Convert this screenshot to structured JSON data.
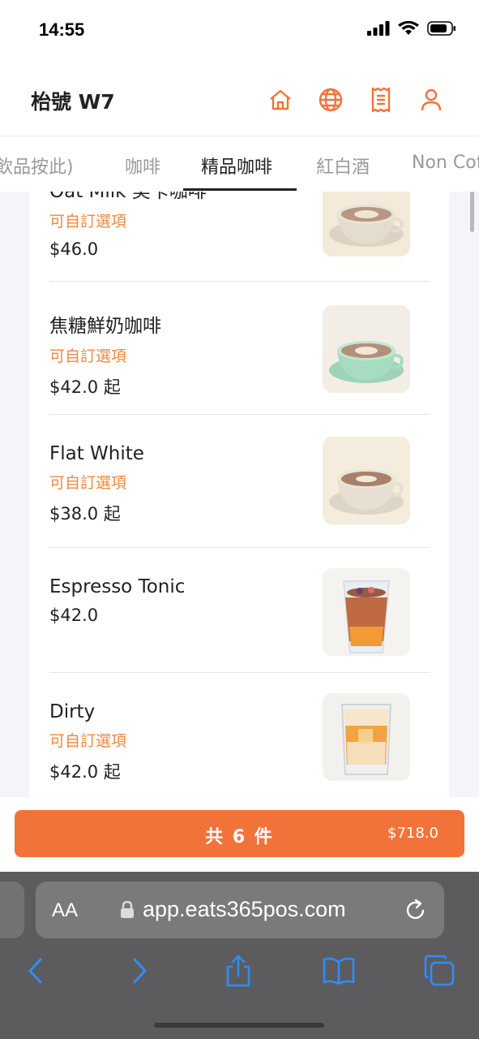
{
  "status": {
    "time": "14:55"
  },
  "header": {
    "store_name": "枱號 W7",
    "icons": [
      "home-icon",
      "globe-icon",
      "receipt-icon",
      "user-icon"
    ],
    "accent_color": "#f0733a"
  },
  "tabs": {
    "items": [
      "飲品按此)",
      "咖啡",
      "精品咖啡",
      "紅白酒",
      "Non Coffee"
    ],
    "active": "精品咖啡"
  },
  "menu": {
    "items": [
      {
        "name": "Oat Milk 美卡咖啡",
        "option": "可自訂選項",
        "price": "$46.0",
        "image": "latte-cup-beige"
      },
      {
        "name": "焦糖鮮奶咖啡",
        "option": "可自訂選項",
        "price": "$42.0 起",
        "image": "latte-cup-green"
      },
      {
        "name": "Flat White",
        "option": "可自訂選項",
        "price": "$38.0 起",
        "image": "latte-cup-beige"
      },
      {
        "name": "Espresso Tonic",
        "option": "",
        "price": "$42.0",
        "image": "iced-espresso-tonic"
      },
      {
        "name": "Dirty",
        "option": "可自訂選項",
        "price": "$42.0 起",
        "image": "dirty-coffee-glass"
      }
    ]
  },
  "cart": {
    "count_label": "共 6 件",
    "total": "$718.0",
    "button_color": "#f2733a"
  },
  "browser": {
    "aa_label": "AA",
    "url": "app.eats365pos.com",
    "nav_icons": [
      "back-icon",
      "forward-icon",
      "share-icon",
      "bookmarks-icon",
      "tabs-icon"
    ]
  }
}
